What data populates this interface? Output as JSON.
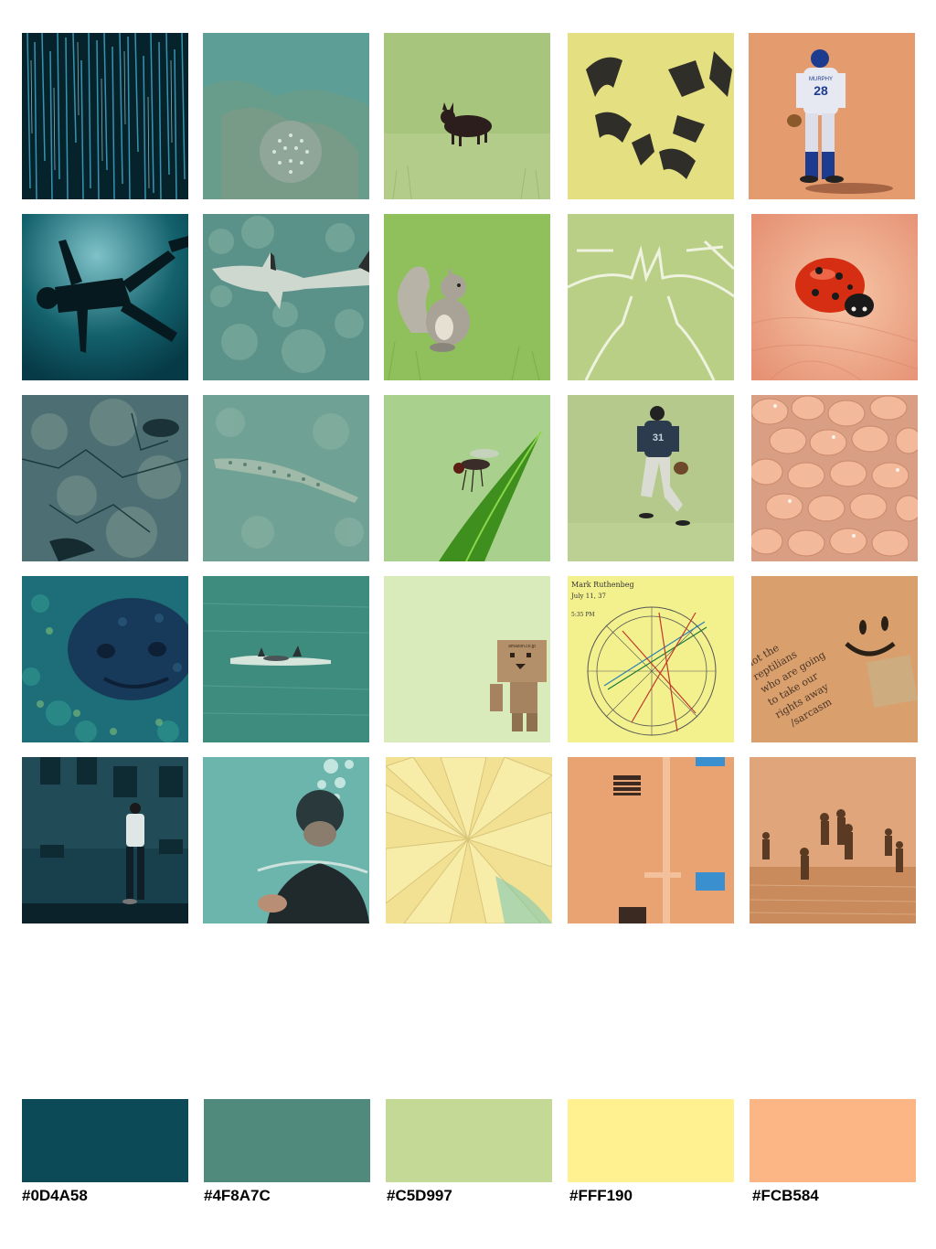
{
  "colors": {
    "palette": [
      "#0D4A58",
      "#4F8A7C",
      "#C5D997",
      "#FFF190",
      "#FCB584"
    ]
  },
  "photos": [
    [
      "light-streaks-photo",
      "coral-underwater-photo",
      "fox-in-grass-photo",
      "graffiti-stencil-photo",
      "baseball-player-photo"
    ],
    [
      "diver-silhouette-photo",
      "reef-shark-photo",
      "squirrel-photo",
      "chalk-lines-grass-photo",
      "ladybug-photo"
    ],
    [
      "rock-texture-photo",
      "lizardfish-photo",
      "fly-on-leaf-photo",
      "outfielder-photo",
      "beans-photo"
    ],
    [
      "grouper-fish-photo",
      "dolphins-photo",
      "danbo-figure-photo",
      "astrology-chart-photo",
      "smiley-wall-photo"
    ],
    [
      "street-man-photo",
      "scuba-diver-photo",
      "paper-fan-photo",
      "orange-building-photo",
      "beach-children-photo"
    ]
  ],
  "swatch_labels": [
    "#0D4A58",
    "#4F8A7C",
    "#C5D997",
    "#FFF190",
    "#FCB584"
  ],
  "text": {
    "player_number": "28",
    "player_name": "MURPHY",
    "outfielder_number": "31",
    "danbo_label": "amazon.co.jp",
    "note_line1": "not the",
    "note_line2": "reptilians",
    "note_line3": "who are going",
    "note_line4": "to take our",
    "note_line5": "rights away",
    "note_line6": "/sarcasm",
    "chart_heading": "Mark Ruthenbeg",
    "chart_date": "July 11, 37",
    "chart_time": "5:35 PM"
  }
}
